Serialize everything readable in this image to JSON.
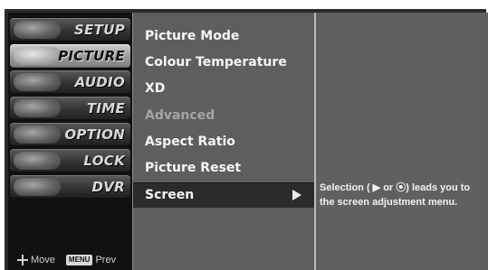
{
  "sidebar": {
    "items": [
      {
        "label": "SETUP",
        "icon": "satellite-dish-icon"
      },
      {
        "label": "PICTURE",
        "icon": "color-swatch-icon"
      },
      {
        "label": "AUDIO",
        "icon": "speaker-icon"
      },
      {
        "label": "TIME",
        "icon": "clock-icon"
      },
      {
        "label": "OPTION",
        "icon": "option-badge-icon"
      },
      {
        "label": "LOCK",
        "icon": "lock-icon"
      },
      {
        "label": "DVR",
        "icon": "disc-icon"
      }
    ],
    "selected_index": 1
  },
  "hints": {
    "move_label": "Move",
    "menu_key": "MENU",
    "prev_label": "Prev"
  },
  "menu": {
    "items": [
      {
        "label": "Picture Mode",
        "state": "normal"
      },
      {
        "label": "Colour Temperature",
        "state": "normal"
      },
      {
        "label": "XD",
        "state": "normal"
      },
      {
        "label": "Advanced",
        "state": "disabled"
      },
      {
        "label": "Aspect Ratio",
        "state": "normal"
      },
      {
        "label": "Picture Reset",
        "state": "normal"
      },
      {
        "label": "Screen",
        "state": "selected",
        "has_submenu": true
      }
    ]
  },
  "help": {
    "text_line1": "Selection ( ▶ or ⦿) leads you to",
    "text_line2": "the screen adjustment menu."
  },
  "colors": {
    "osd_background": "#2a2a2a",
    "menu_background": "#5e5e5e",
    "selected_row": "#2b2b2b",
    "help_background": "#606060"
  }
}
